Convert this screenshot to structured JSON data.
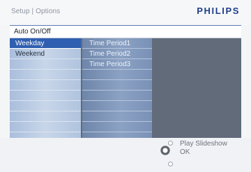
{
  "header": {
    "breadcrumb": "Setup | Options",
    "brand": "PHILIPS"
  },
  "menu": {
    "title": "Auto On/Off",
    "items": [
      {
        "label": "Weekday",
        "selected": true
      },
      {
        "label": "Weekend",
        "selected": false
      }
    ]
  },
  "submenu": {
    "items": [
      {
        "label": "Time Period1"
      },
      {
        "label": "Time Period2"
      },
      {
        "label": "Time Period3"
      }
    ]
  },
  "footer": {
    "play_hint": "Play Slideshow",
    "ok_hint": "OK"
  },
  "colors": {
    "brand": "#1d3f8a",
    "selection": "#2f5fb0",
    "panel": "#616b7a"
  },
  "icons": [
    "up-nav-icon",
    "ok-button-icon",
    "down-nav-icon"
  ]
}
